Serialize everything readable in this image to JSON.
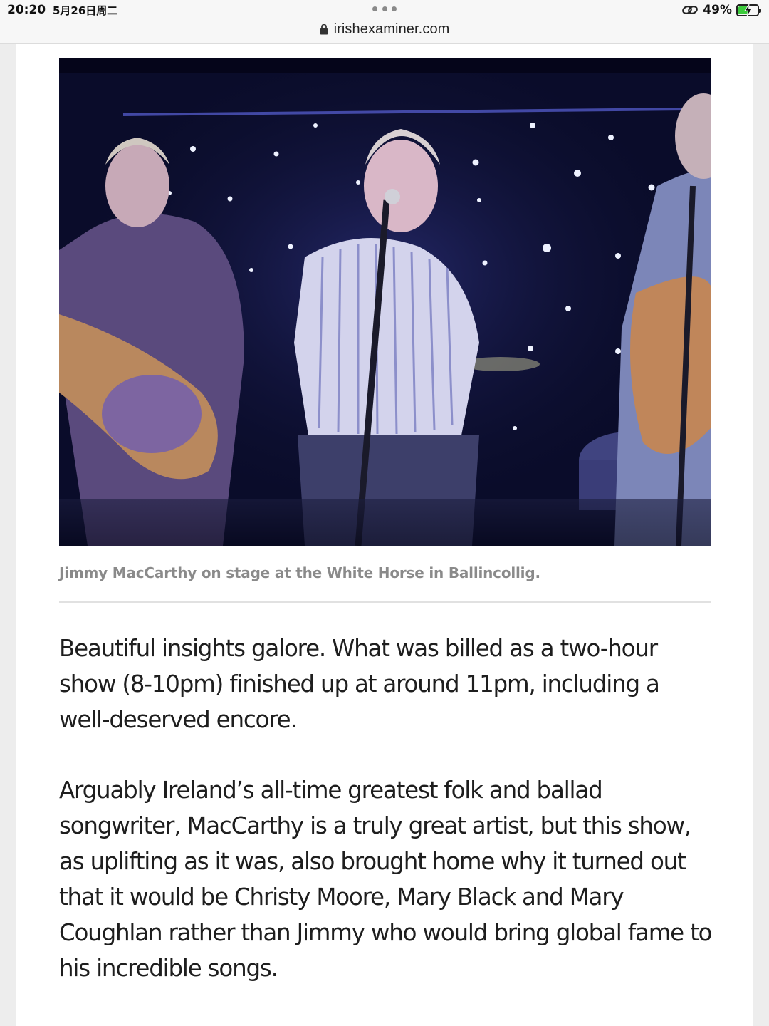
{
  "status_bar": {
    "time": "20:20",
    "date": "5月26日周二",
    "battery_percent": "49%",
    "battery_level": 0.49,
    "charging": true
  },
  "browser": {
    "url": "irishexaminer.com"
  },
  "article": {
    "image_caption": "Jimmy MacCarthy on stage at the White Horse in Ballincollig.",
    "paragraphs": [
      "Beautiful insights galore. What was billed as a two-hour show (8-10pm) finished up at around 11pm, including a well-deserved encore.",
      "Arguably Ireland’s all-time greatest folk and ballad songwriter, MacCarthy is a truly great artist, but this show, as uplifting as it was, also brought home why it turned out that it would be Christy Moore, Mary Black and Mary Coughlan rather than Jimmy who would bring global fame to his incredible songs."
    ]
  },
  "icons": {
    "lock": "lock-icon",
    "link": "link-icon",
    "battery": "battery-icon",
    "more": "more-dots-icon"
  },
  "colors": {
    "battery_fill": "#3ccb3c",
    "caption": "#8a8a8a",
    "stage_backdrop": "#0c0e2e"
  }
}
